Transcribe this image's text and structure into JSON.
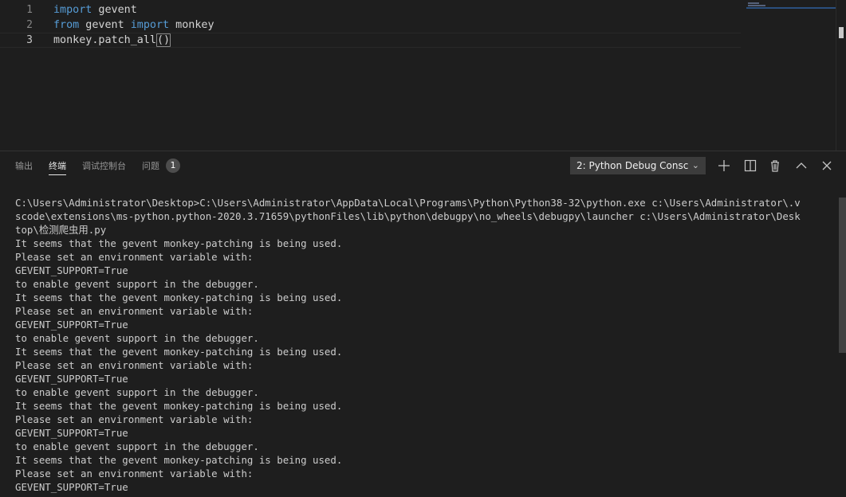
{
  "editor": {
    "lines": [
      {
        "number": "1",
        "tokens": [
          {
            "text": "import",
            "kind": "keyword"
          },
          {
            "text": " gevent",
            "kind": "plain"
          }
        ]
      },
      {
        "number": "2",
        "tokens": [
          {
            "text": "from",
            "kind": "keyword"
          },
          {
            "text": " gevent ",
            "kind": "plain"
          },
          {
            "text": "import",
            "kind": "keyword"
          },
          {
            "text": " monkey",
            "kind": "plain"
          }
        ]
      },
      {
        "number": "3",
        "tokens": [
          {
            "text": "monkey.patch_all",
            "kind": "plain"
          },
          {
            "text": "()",
            "kind": "bracket-match"
          }
        ]
      }
    ]
  },
  "panel": {
    "tabs": [
      {
        "label": "输出",
        "active": false
      },
      {
        "label": "终端",
        "active": true
      },
      {
        "label": "调试控制台",
        "active": false
      },
      {
        "label": "问题",
        "active": false
      }
    ],
    "problems_count": "1",
    "terminal_selector": "2: Python Debug Consc",
    "toolbar_icons": [
      "plus-icon",
      "split-icon",
      "trash-icon",
      "chevron-up-icon",
      "close-icon"
    ]
  },
  "terminal": {
    "lines": [
      "C:\\Users\\Administrator\\Desktop>C:\\Users\\Administrator\\AppData\\Local\\Programs\\Python\\Python38-32\\python.exe c:\\Users\\Administrator\\.v",
      "scode\\extensions\\ms-python.python-2020.3.71659\\pythonFiles\\lib\\python\\debugpy\\no_wheels\\debugpy\\launcher c:\\Users\\Administrator\\Desk",
      "top\\检测爬虫用.py",
      "It seems that the gevent monkey-patching is being used.",
      "Please set an environment variable with:",
      "GEVENT_SUPPORT=True",
      "to enable gevent support in the debugger.",
      "It seems that the gevent monkey-patching is being used.",
      "Please set an environment variable with:",
      "GEVENT_SUPPORT=True",
      "to enable gevent support in the debugger.",
      "It seems that the gevent monkey-patching is being used.",
      "Please set an environment variable with:",
      "GEVENT_SUPPORT=True",
      "to enable gevent support in the debugger.",
      "It seems that the gevent monkey-patching is being used.",
      "Please set an environment variable with:",
      "GEVENT_SUPPORT=True",
      "to enable gevent support in the debugger.",
      "It seems that the gevent monkey-patching is being used.",
      "Please set an environment variable with:",
      "GEVENT_SUPPORT=True"
    ]
  },
  "colors": {
    "background": "#1e1e1e",
    "keyword": "#569cd6",
    "text": "#cccccc",
    "line_number": "#858585"
  }
}
